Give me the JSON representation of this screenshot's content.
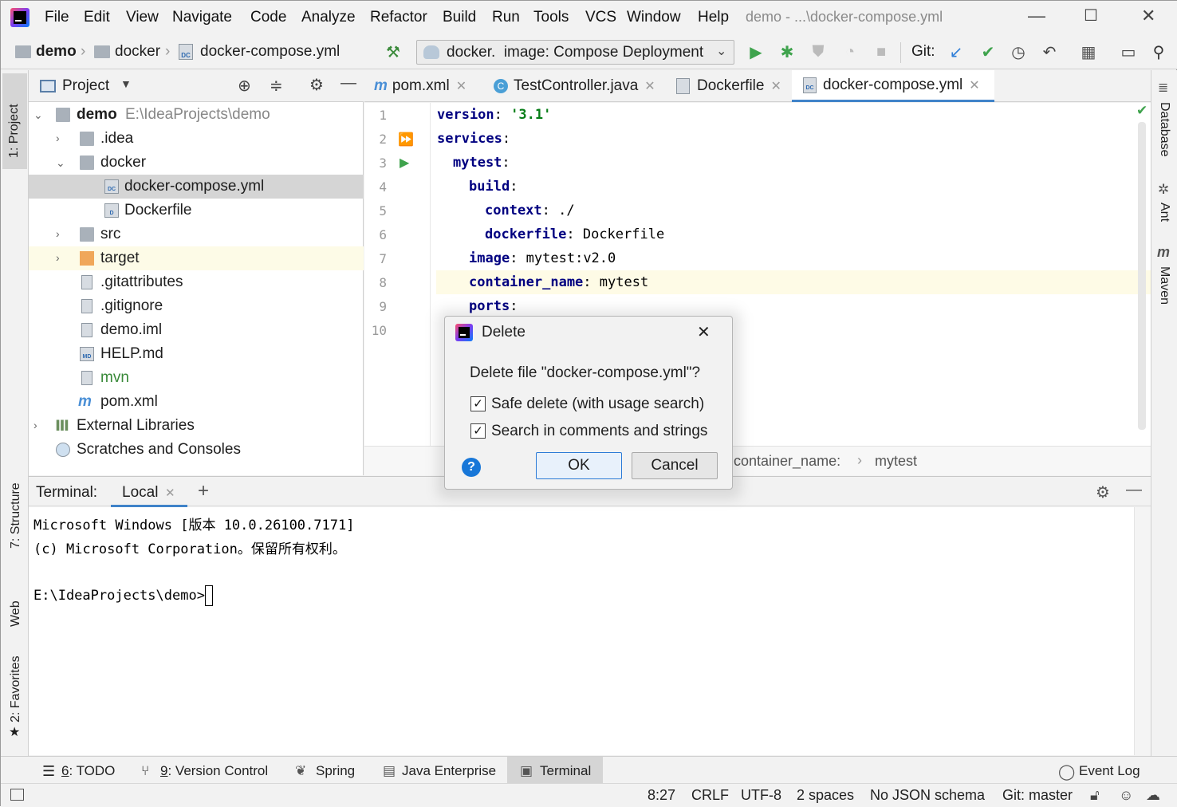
{
  "menu": {
    "items": [
      "File",
      "Edit",
      "View",
      "Navigate",
      "Code",
      "Analyze",
      "Refactor",
      "Build",
      "Run",
      "Tools",
      "VCS",
      "Window",
      "Help"
    ],
    "window_title": "demo - ...\\docker-compose.yml"
  },
  "navbar": {
    "crumbs": [
      "demo",
      "docker",
      "docker-compose.yml"
    ],
    "run_config": "docker.  image: Compose Deployment",
    "git_label": "Git:"
  },
  "left_stripe": {
    "project": "1: Project",
    "structure": "7: Structure",
    "web": "Web",
    "favorites": "2: Favorites"
  },
  "right_stripe": {
    "database": "Database",
    "ant": "Ant",
    "maven": "Maven"
  },
  "project_panel": {
    "title": "Project",
    "tree": [
      {
        "label": "demo",
        "extra": "E:\\IdeaProjects\\demo"
      },
      {
        "label": ".idea"
      },
      {
        "label": "docker"
      },
      {
        "label": "docker-compose.yml"
      },
      {
        "label": "Dockerfile"
      },
      {
        "label": "src"
      },
      {
        "label": "target"
      },
      {
        "label": ".gitattributes"
      },
      {
        "label": ".gitignore"
      },
      {
        "label": "demo.iml"
      },
      {
        "label": "HELP.md"
      },
      {
        "label": "mvn"
      },
      {
        "label": "pom.xml"
      },
      {
        "label": "External Libraries"
      },
      {
        "label": "Scratches and Consoles"
      }
    ]
  },
  "editor": {
    "tabs": [
      "pom.xml",
      "TestController.java",
      "Dockerfile",
      "docker-compose.yml"
    ],
    "line_numbers": [
      "1",
      "2",
      "3",
      "4",
      "5",
      "6",
      "7",
      "8",
      "9",
      "10"
    ],
    "lines": [
      {
        "key": "version",
        "sep": ": ",
        "val": "'3.1'"
      },
      {
        "key": "services",
        "sep": ":",
        "val": ""
      },
      {
        "key": "mytest",
        "sep": ":",
        "val": ""
      },
      {
        "key": "build",
        "sep": ":",
        "val": ""
      },
      {
        "key": "context",
        "sep": ": ",
        "val": "./"
      },
      {
        "key": "dockerfile",
        "sep": ": ",
        "val": "Dockerfile"
      },
      {
        "key": "image",
        "sep": ": ",
        "val": "mytest:v2.0"
      },
      {
        "key": "container_name",
        "sep": ": ",
        "val": "mytest"
      },
      {
        "key": "ports",
        "sep": ":",
        "val": ""
      }
    ],
    "breadcrumb": [
      "container_name:",
      "mytest"
    ]
  },
  "terminal": {
    "label": "Terminal:",
    "tab": "Local",
    "lines": [
      "Microsoft Windows [版本 10.0.26100.7171]",
      "(c) Microsoft Corporation。保留所有权利。",
      "",
      "E:\\IdeaProjects\\demo>"
    ]
  },
  "toolstrip": {
    "todo": {
      "num": "6",
      "label": ": TODO"
    },
    "vcs": {
      "num": "9",
      "label": ": Version Control"
    },
    "spring": "Spring",
    "java_ee": "Java Enterprise",
    "terminal": "Terminal",
    "event_log": "Event Log"
  },
  "status": {
    "position": "8:27",
    "line_sep": "CRLF",
    "encoding": "UTF-8",
    "indent": "2 spaces",
    "schema": "No JSON schema",
    "git": "Git: master"
  },
  "dialog": {
    "title": "Delete",
    "message": "Delete file \"docker-compose.yml\"?",
    "opt1": "Safe delete (with usage search)",
    "opt1_checked": true,
    "opt2": "Search in comments and strings",
    "opt2_checked": true,
    "ok": "OK",
    "cancel": "Cancel"
  }
}
